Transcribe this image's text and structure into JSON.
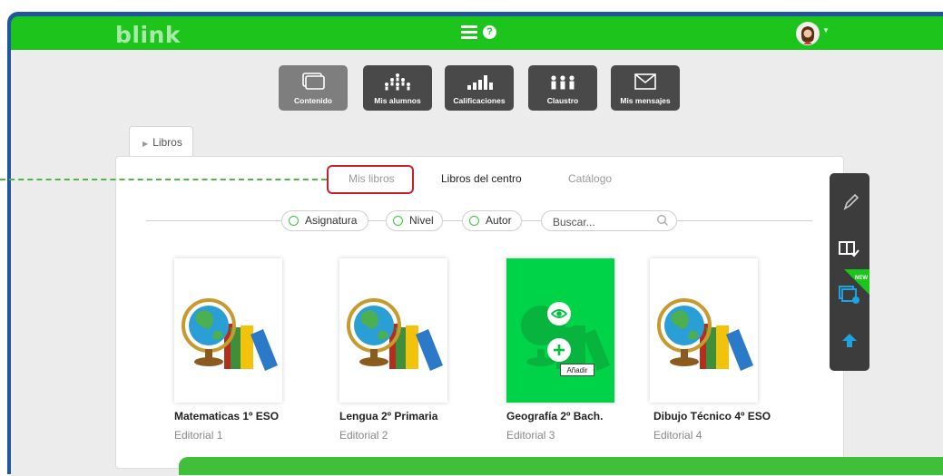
{
  "app": {
    "logo": "blink"
  },
  "nav": {
    "buttons": [
      {
        "label": "Contenido",
        "icon": "screens-icon",
        "active": true
      },
      {
        "label": "Mis alumnos",
        "icon": "students-icon",
        "active": false
      },
      {
        "label": "Calificaciones",
        "icon": "bar-chart-icon",
        "active": false
      },
      {
        "label": "Claustro",
        "icon": "staff-icon",
        "active": false
      },
      {
        "label": "Mis mensajes",
        "icon": "envelope-icon",
        "active": false
      }
    ]
  },
  "breadcrumb_tab": "Libros",
  "subtabs": {
    "mis_libros": "Mis libros",
    "libros_centro": "Libros del centro",
    "catalogo": "Catálogo"
  },
  "filters": {
    "asignatura": "Asignatura",
    "nivel": "Nivel",
    "autor": "Autor"
  },
  "search": {
    "placeholder": "Buscar..."
  },
  "books": [
    {
      "title": "Matematicas 1º ESO",
      "publisher": "Editorial 1"
    },
    {
      "title": "Lengua 2º Primaria",
      "publisher": "Editorial 2"
    },
    {
      "title": "Geografía 2º Bach.",
      "publisher": "Editorial 3"
    },
    {
      "title": "Dibujo Técnico 4º ESO",
      "publisher": "Editorial 4"
    }
  ],
  "tooltip": "Añadir",
  "tools": {
    "new_badge": "NEW"
  },
  "colors": {
    "brand_green": "#1cc41c",
    "highlight_red": "#c8202e",
    "hover_green": "#00d347",
    "dark_toolbar": "#3c3c3c"
  }
}
